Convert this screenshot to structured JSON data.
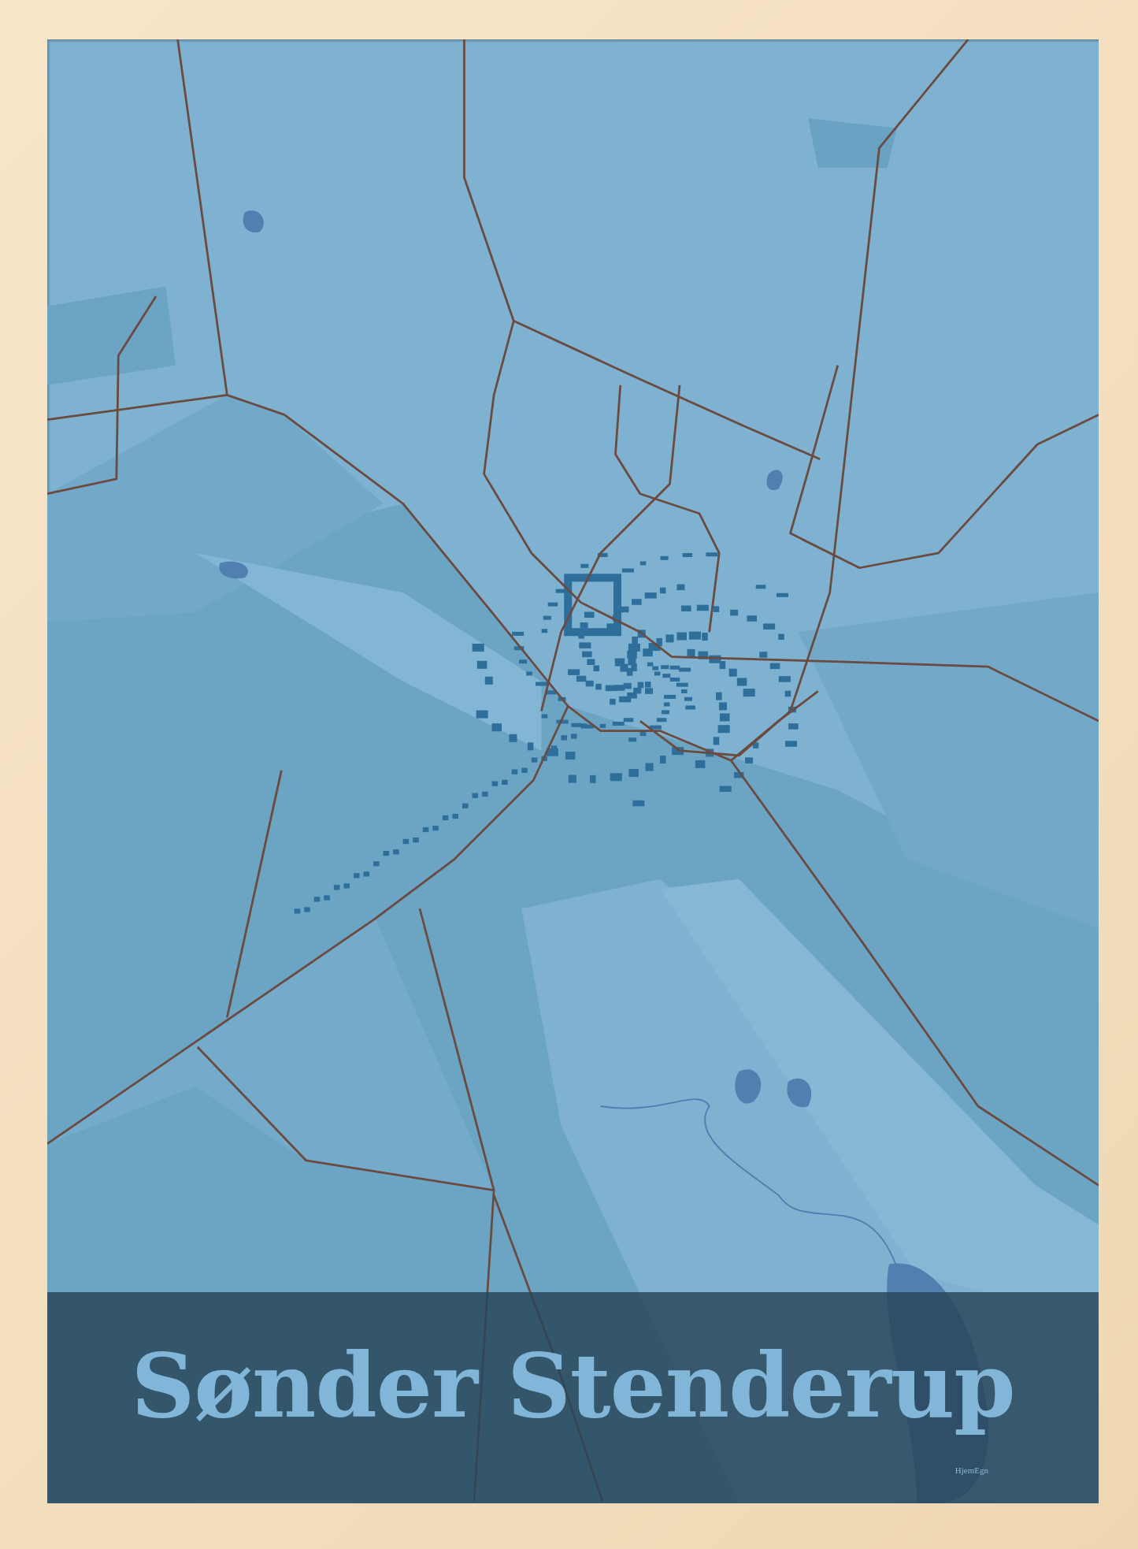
{
  "poster": {
    "title": "Sønder Stenderup",
    "logo": "HjemEgn"
  }
}
